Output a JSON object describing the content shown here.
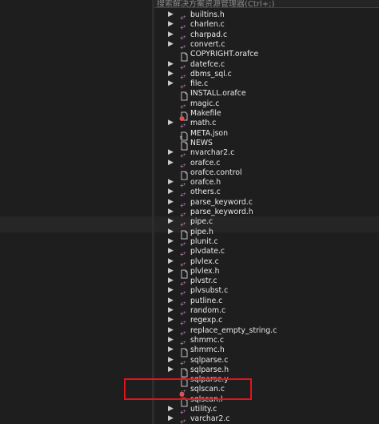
{
  "search": {
    "placeholder": "搜索解决方案资源管理器(Ctrl+;)"
  },
  "colors": {
    "accent_red": "#e3131c",
    "c_icon": "#c586c0",
    "file_icon": "#bfbfbf",
    "git_red": "#e05252"
  },
  "tree": {
    "items": [
      {
        "label": "builtins.h",
        "icon": "c-file-icon",
        "expandable": true
      },
      {
        "label": "charlen.c",
        "icon": "c-file-icon",
        "expandable": true
      },
      {
        "label": "charpad.c",
        "icon": "c-file-icon",
        "expandable": true
      },
      {
        "label": "convert.c",
        "icon": "c-file-icon",
        "expandable": true
      },
      {
        "label": "COPYRIGHT.orafce",
        "icon": "file-icon",
        "expandable": false
      },
      {
        "label": "datefce.c",
        "icon": "c-file-icon",
        "expandable": true
      },
      {
        "label": "dbms_sql.c",
        "icon": "c-file-icon",
        "expandable": true
      },
      {
        "label": "file.c",
        "icon": "c-file-icon",
        "expandable": true
      },
      {
        "label": "INSTALL.orafce",
        "icon": "file-icon",
        "expandable": false
      },
      {
        "label": "magic.c",
        "icon": "c-file-icon",
        "expandable": false
      },
      {
        "label": "Makefile",
        "icon": "makefile-icon",
        "expandable": false
      },
      {
        "label": "math.c",
        "icon": "c-file-icon",
        "expandable": true
      },
      {
        "label": "META.json",
        "icon": "json-icon",
        "expandable": false
      },
      {
        "label": "NEWS",
        "icon": "file-icon",
        "expandable": false
      },
      {
        "label": "nvarchar2.c",
        "icon": "c-file-icon",
        "expandable": true
      },
      {
        "label": "orafce.c",
        "icon": "c-file-icon",
        "expandable": true
      },
      {
        "label": "orafce.control",
        "icon": "file-icon",
        "expandable": false
      },
      {
        "label": "orafce.h",
        "icon": "c-file-icon",
        "expandable": true
      },
      {
        "label": "others.c",
        "icon": "c-file-icon",
        "expandable": true
      },
      {
        "label": "parse_keyword.c",
        "icon": "c-file-icon",
        "expandable": true
      },
      {
        "label": "parse_keyword.h",
        "icon": "c-file-icon",
        "expandable": true
      },
      {
        "label": "pipe.c",
        "icon": "c-file-icon",
        "expandable": true
      },
      {
        "label": "pipe.h",
        "icon": "file-icon",
        "expandable": true
      },
      {
        "label": "plunit.c",
        "icon": "c-file-icon",
        "expandable": true
      },
      {
        "label": "plvdate.c",
        "icon": "c-file-icon",
        "expandable": true
      },
      {
        "label": "plvlex.c",
        "icon": "c-file-icon",
        "expandable": true
      },
      {
        "label": "plvlex.h",
        "icon": "file-icon",
        "expandable": true
      },
      {
        "label": "plvstr.c",
        "icon": "c-file-icon",
        "expandable": true
      },
      {
        "label": "plvsubst.c",
        "icon": "c-file-icon",
        "expandable": true
      },
      {
        "label": "putline.c",
        "icon": "c-file-icon",
        "expandable": true
      },
      {
        "label": "random.c",
        "icon": "c-file-icon",
        "expandable": true
      },
      {
        "label": "regexp.c",
        "icon": "c-file-icon",
        "expandable": true
      },
      {
        "label": "replace_empty_string.c",
        "icon": "c-file-icon",
        "expandable": true
      },
      {
        "label": "shmmc.c",
        "icon": "c-file-icon",
        "expandable": true
      },
      {
        "label": "shmmc.h",
        "icon": "file-icon",
        "expandable": true
      },
      {
        "label": "sqlparse.c",
        "icon": "c-file-icon",
        "expandable": true
      },
      {
        "label": "sqlparse.h",
        "icon": "file-icon",
        "expandable": true
      },
      {
        "label": "sqlparse.y",
        "icon": "file-icon",
        "expandable": false
      },
      {
        "label": "sqlscan.c",
        "icon": "c-file-git-icon",
        "expandable": false
      },
      {
        "label": "sqlscan.l",
        "icon": "file-icon",
        "expandable": false
      },
      {
        "label": "utility.c",
        "icon": "c-file-icon",
        "expandable": true
      },
      {
        "label": "varchar2.c",
        "icon": "c-file-icon",
        "expandable": true
      }
    ]
  }
}
